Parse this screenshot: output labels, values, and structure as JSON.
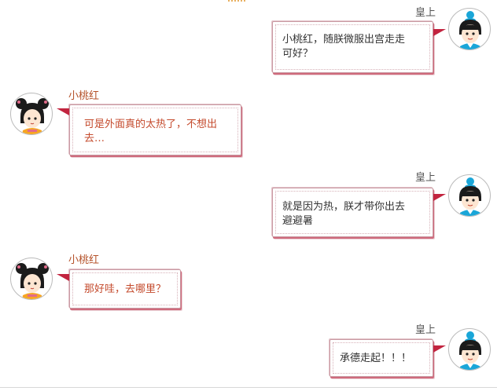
{
  "messages": [
    {
      "speaker": "皇上",
      "text": "小桃红，随朕微服出宫走走可好？",
      "line1": "小桃红，随朕微服出宫走走",
      "line2": "可好？",
      "side": "right"
    },
    {
      "speaker": "小桃红",
      "text": "可是外面真的太热了，不想出去…",
      "line1": "可是外面真的太热了，不想出",
      "line2": "去…",
      "side": "left"
    },
    {
      "speaker": "皇上",
      "text": "就是因为热，朕才带你出去避避暑",
      "line1": "就是因为热，朕才带你出去",
      "line2": "避避暑",
      "side": "right"
    },
    {
      "speaker": "小桃红",
      "text": "那好哇，去哪里？",
      "line1": "那好哇，去哪里？",
      "side": "left"
    },
    {
      "speaker": "皇上",
      "text": "承德走起！！！",
      "line1": "承德走起！！！",
      "side": "right"
    }
  ],
  "colors": {
    "accent_red": "#c2243f",
    "maid_name": "#b5522a",
    "maid_text": "#c44a2c",
    "emperor_hat": "#1aa6d8"
  },
  "icons": {
    "emperor": "emperor-avatar-icon",
    "maid": "maid-avatar-icon"
  }
}
